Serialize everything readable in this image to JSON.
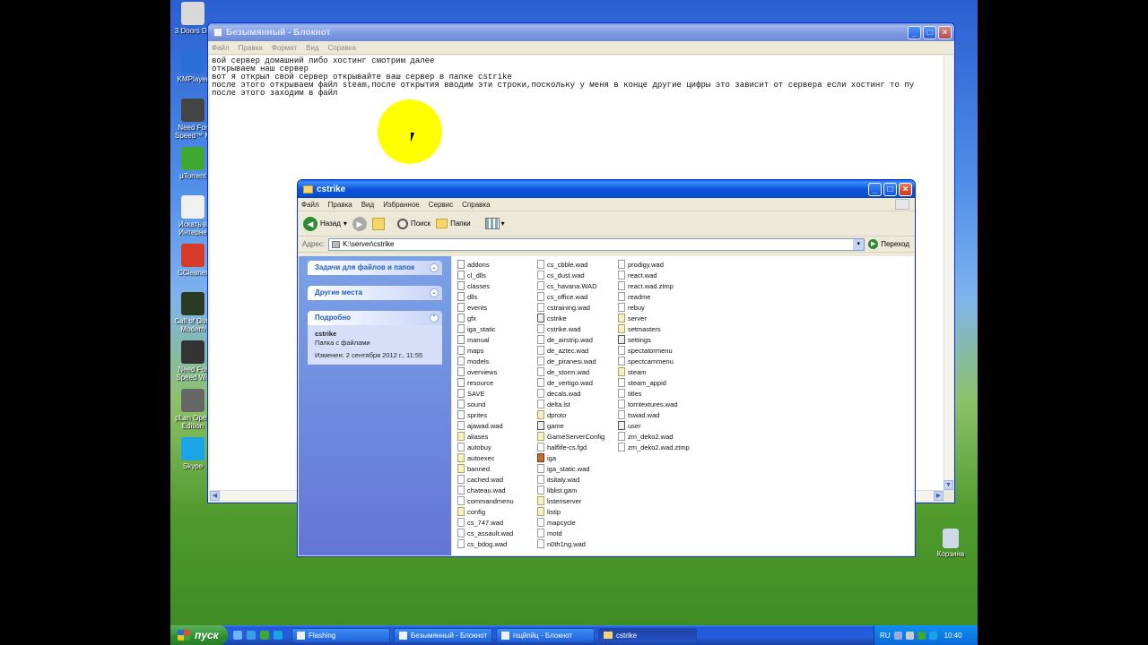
{
  "desktop": {
    "icons": [
      {
        "label": "3 Doors Do",
        "icon": "folder-icon",
        "color": "#d8d8d8"
      },
      {
        "label": "KMPlayer",
        "icon": "kmplayer-icon",
        "color": "#2a6fd6"
      },
      {
        "label": "Need For\nSpeed™ M",
        "icon": "nfs-mw-icon",
        "color": "#444444"
      },
      {
        "label": "µTorrent",
        "icon": "utorrent-icon",
        "color": "#3fa832"
      },
      {
        "label": "Искать в\nИнтерне",
        "icon": "search-document-icon",
        "color": "#f0f0f0"
      },
      {
        "label": "CCleaner",
        "icon": "ccleaner-icon",
        "color": "#d83a2a"
      },
      {
        "label": "Call of Duty\nModern",
        "icon": "cod-icon",
        "color": "#2b3a22"
      },
      {
        "label": "Need For\nSpeed Wo",
        "icon": "nfs-world-icon",
        "color": "#333333"
      },
      {
        "label": "pLan Open\nEdition",
        "icon": "plan-icon",
        "color": "#666666"
      },
      {
        "label": "Skype",
        "icon": "skype-icon",
        "color": "#1ba3e8"
      }
    ],
    "recycle_bin": "Корзина"
  },
  "notepad": {
    "title": "Безымянный - Блокнот",
    "menu": [
      "Файл",
      "Правка",
      "Формат",
      "Вид",
      "Справка"
    ],
    "text": "вой сервер домашний либо хостинг смотрим далее\nоткрываем наш сервер\nвот я открыл свой сервер открывайте ваш сервер в папке cstrike\nпосле этого открываем файл steam,после открытия вводим эти строки,поскольку у меня в конце другие цифры это зависит от сервера если хостинг то пу\nпосле этого заходим в файл"
  },
  "explorer": {
    "title": "cstrike",
    "menu": [
      "Файл",
      "Правка",
      "Вид",
      "Избранное",
      "Сервис",
      "Справка"
    ],
    "toolbar": {
      "back": "Назад",
      "search": "Поиск",
      "folders": "Папки"
    },
    "address": {
      "label": "Адрес:",
      "path": "K:\\server\\cstrike",
      "go": "Переход"
    },
    "tasks": {
      "file_tasks": "Задачи для файлов и папок",
      "other_places": "Другие места",
      "details": "Подробно",
      "details_name": "cstrike",
      "details_type": "Папка с файлами",
      "details_modified": "Изменен: 2 сентября 2012 г., 11:55"
    },
    "files_col1": [
      {
        "name": "addons",
        "type": "folder"
      },
      {
        "name": "cl_dlls",
        "type": "folder"
      },
      {
        "name": "classes",
        "type": "folder"
      },
      {
        "name": "dlls",
        "type": "folder"
      },
      {
        "name": "events",
        "type": "folder"
      },
      {
        "name": "gfx",
        "type": "folder"
      },
      {
        "name": "iga_static",
        "type": "folder"
      },
      {
        "name": "manual",
        "type": "folder"
      },
      {
        "name": "maps",
        "type": "folder"
      },
      {
        "name": "models",
        "type": "folder"
      },
      {
        "name": "overviews",
        "type": "folder"
      },
      {
        "name": "resource",
        "type": "folder"
      },
      {
        "name": "SAVE",
        "type": "folder"
      },
      {
        "name": "sound",
        "type": "folder"
      },
      {
        "name": "sprites",
        "type": "folder"
      },
      {
        "name": "ajawad.wad",
        "type": "file"
      },
      {
        "name": "aliases",
        "type": "cfg"
      },
      {
        "name": "autobuy",
        "type": "file"
      },
      {
        "name": "autoexec",
        "type": "cfg"
      },
      {
        "name": "banned",
        "type": "cfg"
      },
      {
        "name": "cached.wad",
        "type": "file"
      },
      {
        "name": "chateau.wad",
        "type": "file"
      },
      {
        "name": "commandmenu",
        "type": "file"
      },
      {
        "name": "config",
        "type": "cfg"
      },
      {
        "name": "cs_747.wad",
        "type": "file"
      },
      {
        "name": "cs_assault.wad",
        "type": "file"
      },
      {
        "name": "cs_bdog.wad",
        "type": "file"
      }
    ],
    "files_col2": [
      {
        "name": "cs_cbble.wad",
        "type": "file"
      },
      {
        "name": "cs_dust.wad",
        "type": "file"
      },
      {
        "name": "cs_havana.WAD",
        "type": "file"
      },
      {
        "name": "cs_office.wad",
        "type": "file"
      },
      {
        "name": "cstraining.wad",
        "type": "file"
      },
      {
        "name": "cstrike",
        "type": "exe"
      },
      {
        "name": "cstrike.wad",
        "type": "file"
      },
      {
        "name": "de_airstrip.wad",
        "type": "file"
      },
      {
        "name": "de_aztec.wad",
        "type": "file"
      },
      {
        "name": "de_piranesi.wad",
        "type": "file"
      },
      {
        "name": "de_storm.wad",
        "type": "file"
      },
      {
        "name": "de_vertigo.wad",
        "type": "file"
      },
      {
        "name": "decals.wad",
        "type": "file"
      },
      {
        "name": "delta.lst",
        "type": "file"
      },
      {
        "name": "dproto",
        "type": "cfg"
      },
      {
        "name": "game",
        "type": "exe"
      },
      {
        "name": "GameServerConfig",
        "type": "cfg"
      },
      {
        "name": "halflife-cs.fgd",
        "type": "file"
      },
      {
        "name": "iga",
        "type": "img"
      },
      {
        "name": "iga_static.wad",
        "type": "file"
      },
      {
        "name": "itsitaly.wad",
        "type": "file"
      },
      {
        "name": "liblist.gam",
        "type": "file"
      },
      {
        "name": "listenserver",
        "type": "cfg"
      },
      {
        "name": "listip",
        "type": "cfg"
      },
      {
        "name": "mapcycle",
        "type": "file"
      },
      {
        "name": "motd",
        "type": "file"
      },
      {
        "name": "n0th1ng.wad",
        "type": "file"
      }
    ],
    "files_col3": [
      {
        "name": "prodigy.wad",
        "type": "file"
      },
      {
        "name": "react.wad",
        "type": "file"
      },
      {
        "name": "react.wad.ztmp",
        "type": "file"
      },
      {
        "name": "readme",
        "type": "file"
      },
      {
        "name": "rebuy",
        "type": "file"
      },
      {
        "name": "server",
        "type": "cfg"
      },
      {
        "name": "setmasters",
        "type": "cfg"
      },
      {
        "name": "settings",
        "type": "exe"
      },
      {
        "name": "spectatormenu",
        "type": "file"
      },
      {
        "name": "spectcammenu",
        "type": "file"
      },
      {
        "name": "steam",
        "type": "cfg"
      },
      {
        "name": "steam_appid",
        "type": "file"
      },
      {
        "name": "titles",
        "type": "file"
      },
      {
        "name": "torntextures.wad",
        "type": "file"
      },
      {
        "name": "tswad.wad",
        "type": "file"
      },
      {
        "name": "user",
        "type": "exe"
      },
      {
        "name": "zm_deko2.wad",
        "type": "file"
      },
      {
        "name": "zm_deko2.wad.ztmp",
        "type": "file"
      }
    ]
  },
  "taskbar": {
    "start": "пуск",
    "tasks": [
      "Flashing",
      "Безымянный - Блокнот",
      "пщйпйц - Блокнот",
      "cstrike"
    ],
    "lang": "RU",
    "clock": "10:40"
  }
}
